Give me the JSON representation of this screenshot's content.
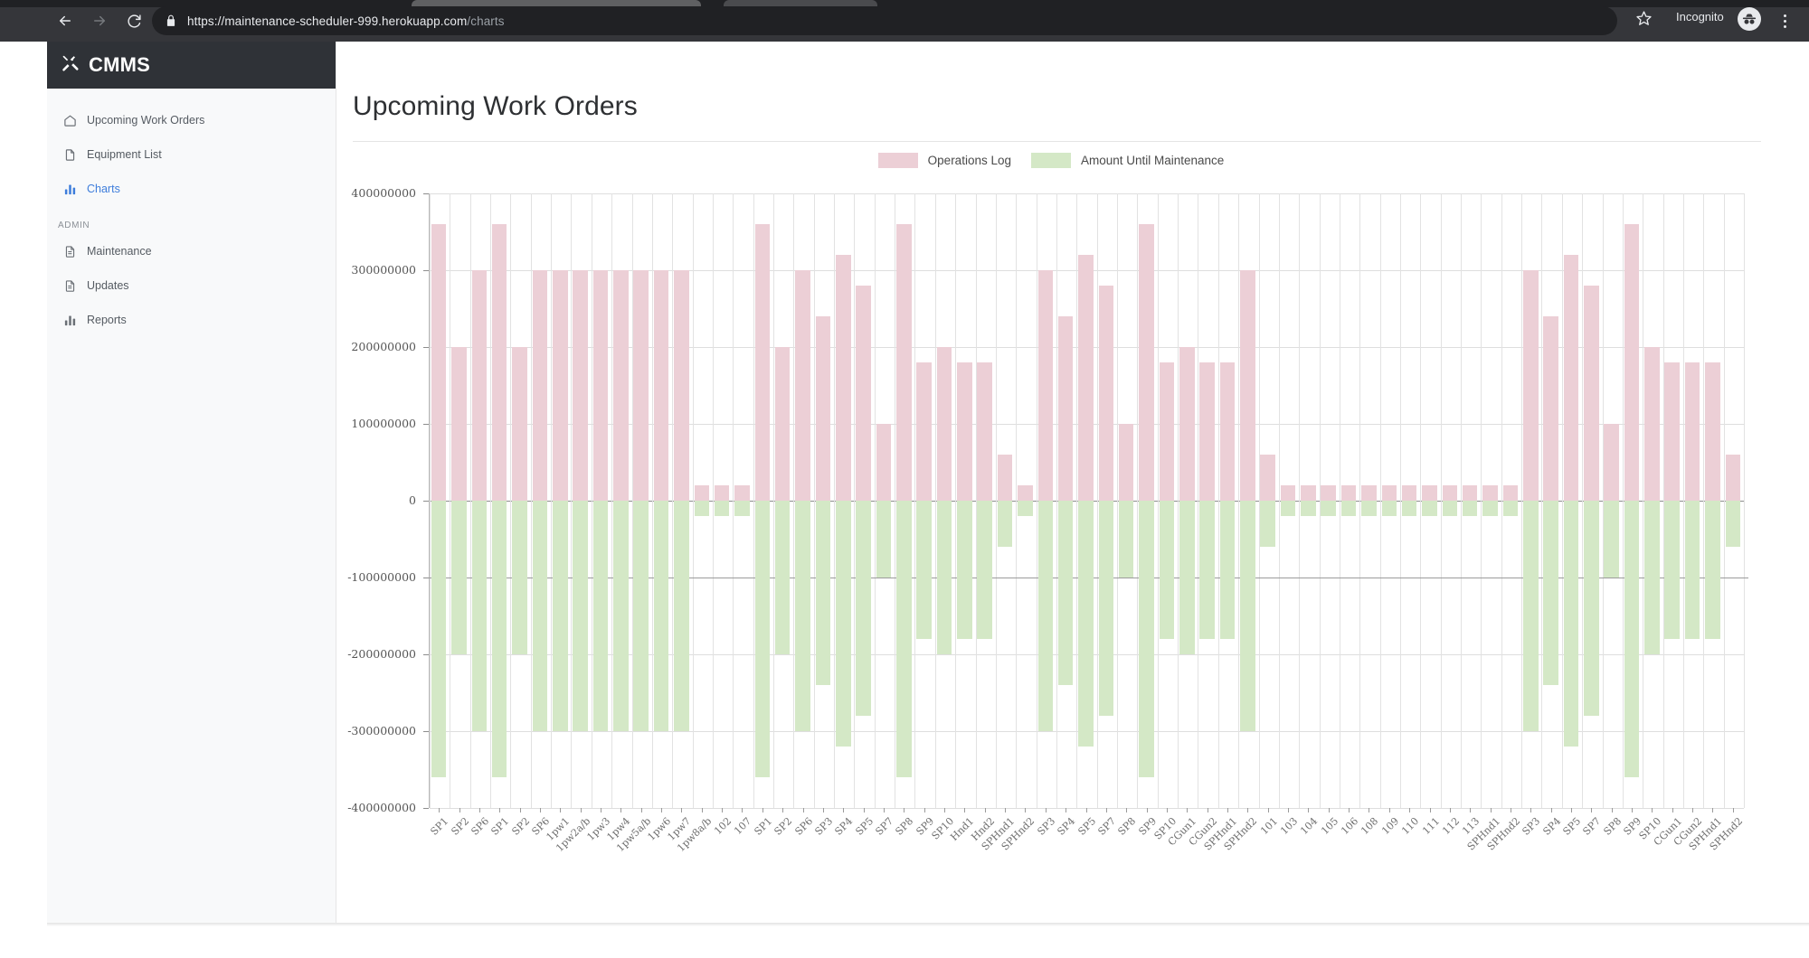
{
  "browser": {
    "back_icon": "back-arrow-icon",
    "forward_icon": "forward-arrow-icon",
    "reload_icon": "reload-icon",
    "lock_icon": "lock-icon",
    "url_secure": "https://maintenance-scheduler-999.herokuapp.com",
    "url_path": "/charts",
    "star_icon": "star-icon",
    "profile_label": "Incognito",
    "avatar_icon": "incognito-avatar-icon",
    "menu_icon": "kebab-menu-icon"
  },
  "sidebar": {
    "brand": "CMMS",
    "brand_icon": "tools-icon",
    "section_label": "ADMIN",
    "items": [
      {
        "label": "Upcoming Work Orders",
        "icon": "home-icon",
        "active": false
      },
      {
        "label": "Equipment List",
        "icon": "document-icon",
        "active": false
      },
      {
        "label": "Charts",
        "icon": "bar-chart-icon",
        "active": true
      }
    ],
    "admin_items": [
      {
        "label": "Maintenance",
        "icon": "file-text-icon",
        "active": false
      },
      {
        "label": "Updates",
        "icon": "file-text-icon",
        "active": false
      },
      {
        "label": "Reports",
        "icon": "bar-chart-icon",
        "active": false
      }
    ]
  },
  "main": {
    "title": "Upcoming Work Orders"
  },
  "colors": {
    "series_positive": "#eccfd6",
    "series_negative": "#d4e8c6",
    "accent": "#3e7ddb",
    "brand_bg": "#2f3237",
    "sidebar_bg": "#f8f9fa",
    "grid": "#dedede",
    "axis": "#8d8d8d"
  },
  "chart_data": {
    "type": "bar",
    "title": "Upcoming Work Orders",
    "xlabel": "",
    "ylabel": "",
    "ylim": [
      -400000000,
      400000000
    ],
    "ytick_labels": [
      "400000000",
      "300000000",
      "200000000",
      "100000000",
      "0",
      "-100000000",
      "-200000000",
      "-300000000",
      "-400000000"
    ],
    "ytick_values": [
      400000000,
      300000000,
      200000000,
      100000000,
      0,
      -100000000,
      -200000000,
      -300000000,
      -400000000
    ],
    "grid": true,
    "legend_position": "top-center",
    "legend": [
      "Operations Log",
      "Amount Until Maintenance"
    ],
    "categories": [
      "SP1",
      "SP2",
      "SP6",
      "SP1",
      "SP2",
      "SP6",
      "1pw1",
      "1pw2a/b",
      "1pw3",
      "1pw4",
      "1pw5a/b",
      "1pw6",
      "1pw7",
      "1pw8a/b",
      "102",
      "107",
      "SP1",
      "SP2",
      "SP6",
      "SP3",
      "SP4",
      "SP5",
      "SP7",
      "SP8",
      "SP9",
      "SP10",
      "Hnd1",
      "Hnd2",
      "SPHnd1",
      "SPHnd2",
      "SP3",
      "SP4",
      "SP5",
      "SP7",
      "SP8",
      "SP9",
      "SP10",
      "CGun1",
      "CGun2",
      "SPHnd1",
      "SPHnd2",
      "101",
      "103",
      "104",
      "105",
      "106",
      "108",
      "109",
      "110",
      "111",
      "112",
      "113",
      "SPHnd1",
      "SPHnd2",
      "SP3",
      "SP4",
      "SP5",
      "SP7",
      "SP8",
      "SP9",
      "SP10",
      "CGun1",
      "CGun2",
      "SPHnd1",
      "SPHnd2"
    ],
    "series": [
      {
        "name": "Operations Log",
        "color": "#eccfd6",
        "values": [
          360000000,
          200000000,
          300000000,
          360000000,
          200000000,
          300000000,
          300000000,
          300000000,
          300000000,
          300000000,
          300000000,
          300000000,
          300000000,
          20000000,
          20000000,
          20000000,
          360000000,
          200000000,
          300000000,
          240000000,
          320000000,
          280000000,
          100000000,
          360000000,
          180000000,
          200000000,
          180000000,
          180000000,
          60000000,
          20000000,
          300000000,
          240000000,
          320000000,
          280000000,
          100000000,
          360000000,
          180000000,
          200000000,
          180000000,
          180000000,
          300000000,
          60000000,
          20000000,
          20000000,
          20000000,
          20000000,
          20000000,
          20000000,
          20000000,
          20000000,
          20000000,
          20000000,
          20000000,
          20000000,
          300000000,
          240000000,
          320000000,
          280000000,
          100000000,
          360000000,
          200000000,
          180000000,
          180000000,
          180000000,
          60000000
        ]
      },
      {
        "name": "Amount Until Maintenance",
        "color": "#d4e8c6",
        "values": [
          -360000000,
          -200000000,
          -300000000,
          -360000000,
          -200000000,
          -300000000,
          -300000000,
          -300000000,
          -300000000,
          -300000000,
          -300000000,
          -300000000,
          -300000000,
          -20000000,
          -20000000,
          -20000000,
          -360000000,
          -200000000,
          -300000000,
          -240000000,
          -320000000,
          -280000000,
          -100000000,
          -360000000,
          -180000000,
          -200000000,
          -180000000,
          -180000000,
          -60000000,
          -20000000,
          -300000000,
          -240000000,
          -320000000,
          -280000000,
          -100000000,
          -360000000,
          -180000000,
          -200000000,
          -180000000,
          -180000000,
          -300000000,
          -60000000,
          -20000000,
          -20000000,
          -20000000,
          -20000000,
          -20000000,
          -20000000,
          -20000000,
          -20000000,
          -20000000,
          -20000000,
          -20000000,
          -20000000,
          -300000000,
          -240000000,
          -320000000,
          -280000000,
          -100000000,
          -360000000,
          -200000000,
          -180000000,
          -180000000,
          -180000000,
          -60000000
        ]
      }
    ]
  }
}
